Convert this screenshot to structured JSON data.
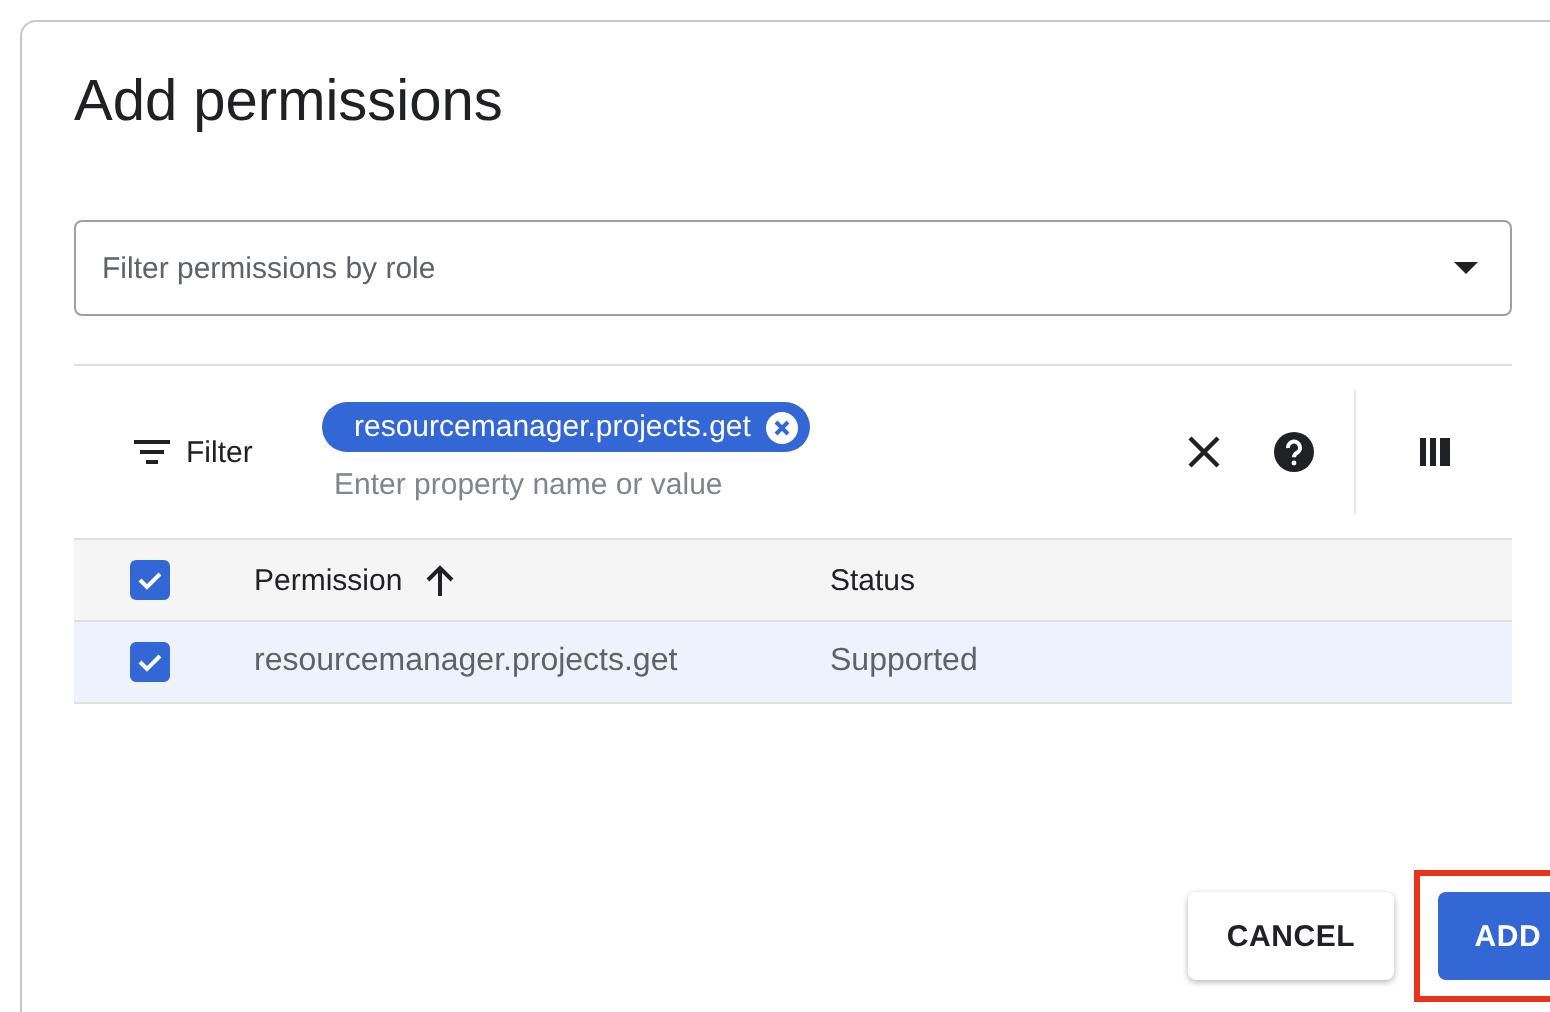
{
  "dialog": {
    "title": "Add permissions"
  },
  "role_filter": {
    "placeholder": "Filter permissions by role"
  },
  "filter_bar": {
    "label": "Filter",
    "chips": [
      {
        "text": "resourcemanager.projects.get"
      }
    ],
    "placeholder": "Enter property name or value"
  },
  "table": {
    "select_all": {
      "checked": true
    },
    "columns": [
      {
        "label": "Permission",
        "sorted": true
      },
      {
        "label": "Status",
        "sorted": false
      }
    ],
    "rows": [
      {
        "checked": true,
        "selected": true,
        "cells": [
          "resourcemanager.projects.get",
          "Supported"
        ]
      }
    ]
  },
  "buttons": [
    {
      "label": "CANCEL",
      "kind": "secondary",
      "highlighted": false
    },
    {
      "label": "ADD",
      "kind": "primary",
      "highlighted": true
    }
  ]
}
